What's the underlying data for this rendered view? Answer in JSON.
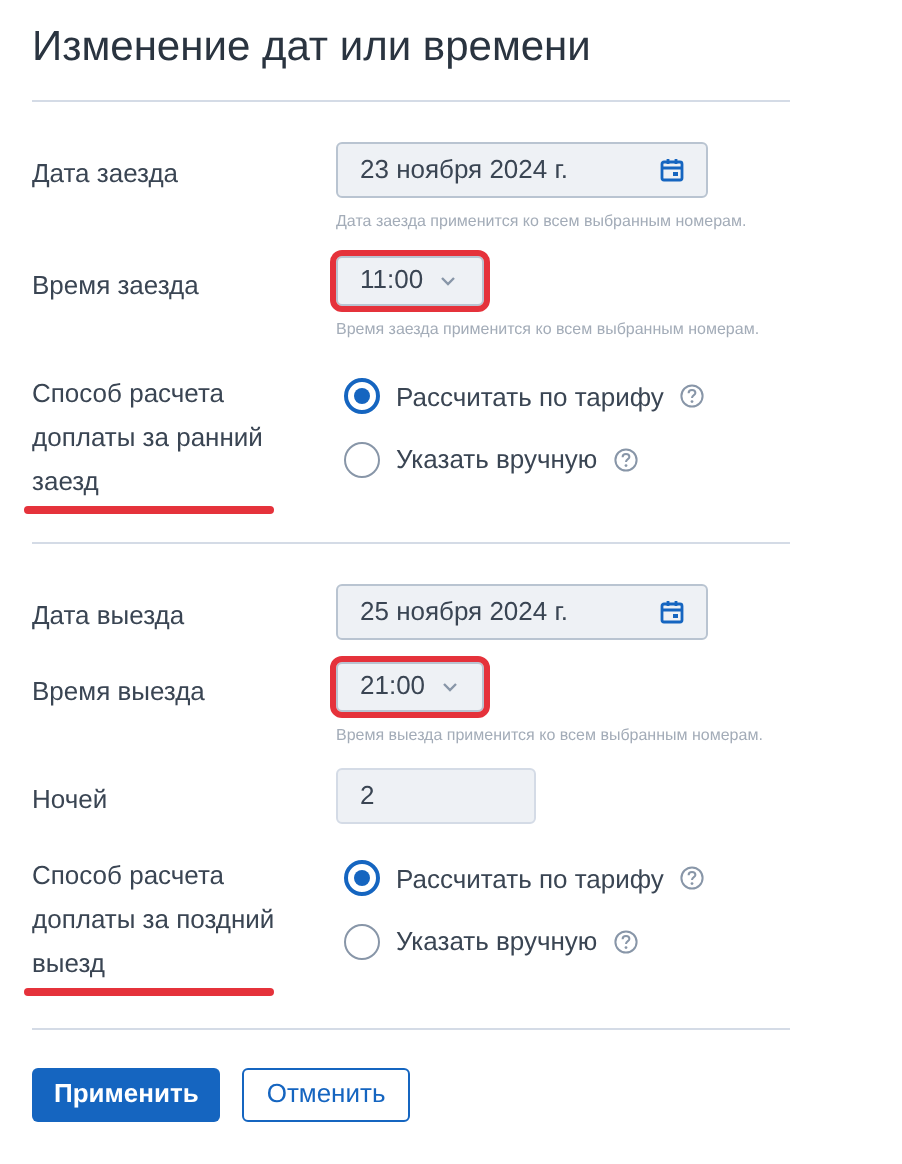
{
  "title": "Изменение дат или времени",
  "sections": [
    {
      "fields": [
        {
          "kind": "date",
          "label": "Дата заезда",
          "value": "23 ноября 2024 г.",
          "hint": "Дата заезда применится ко всем выбранным номерам.",
          "highlighted": false
        },
        {
          "kind": "time",
          "label": "Время заезда",
          "value": "11:00",
          "hint": "Время заезда применится ко всем выбранным номерам.",
          "highlighted": true
        },
        {
          "kind": "radio",
          "label": "Способ расчета доплаты за ранний заезд",
          "underlined": true,
          "options": [
            {
              "label": "Рассчитать по тарифу",
              "selected": true
            },
            {
              "label": "Указать вручную",
              "selected": false
            }
          ]
        }
      ]
    },
    {
      "fields": [
        {
          "kind": "date",
          "label": "Дата выезда",
          "value": "25 ноября 2024 г.",
          "highlighted": false
        },
        {
          "kind": "time",
          "label": "Время выезда",
          "value": "21:00",
          "hint": "Время выезда применится ко всем выбранным номерам.",
          "highlighted": true
        },
        {
          "kind": "number",
          "label": "Ночей",
          "value": "2"
        },
        {
          "kind": "radio",
          "label": "Способ расчета доплаты за поздний выезд",
          "underlined": true,
          "options": [
            {
              "label": "Рассчитать по тарифу",
              "selected": true
            },
            {
              "label": "Указать вручную",
              "selected": false
            }
          ]
        }
      ]
    }
  ],
  "buttons": [
    {
      "label": "Применить",
      "primary": true
    },
    {
      "label": "Отменить",
      "primary": false
    }
  ]
}
